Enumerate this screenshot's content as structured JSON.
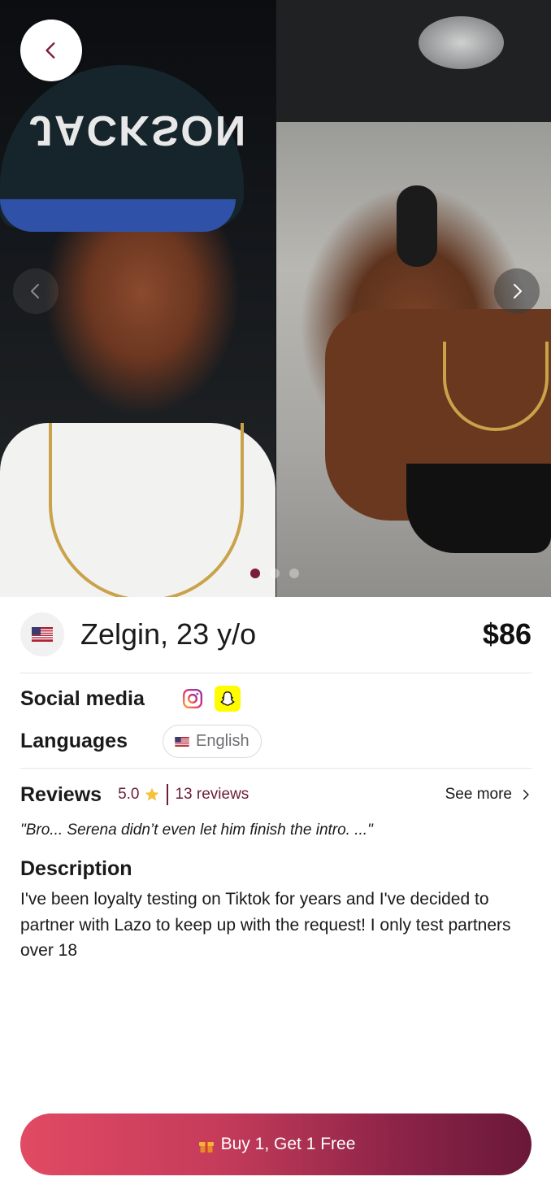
{
  "profile": {
    "name_age": "Zelgin, 23 y/o",
    "price": "$86",
    "country_flag_icon": "us-flag-icon"
  },
  "gallery": {
    "photo_count": 3,
    "active_index": 0,
    "cap_text": "JACKSON"
  },
  "social": {
    "label": "Social media",
    "icons": [
      "instagram-icon",
      "snapchat-icon"
    ]
  },
  "languages": {
    "label": "Languages",
    "items": [
      "English"
    ]
  },
  "reviews": {
    "title": "Reviews",
    "rating": "5.0",
    "count": "13 reviews",
    "see_more": "See more",
    "quote": "\"Bro... Serena didn’t even let him finish the intro. ...\""
  },
  "description": {
    "title": "Description",
    "text": "I've been loyalty testing on Tiktok for years and I've decided to partner with Lazo to keep up with the request! I only test partners over 18"
  },
  "cta": {
    "label": "Buy 1, Get 1 Free",
    "icon": "gift-icon"
  },
  "colors": {
    "accent": "#6b1d3b",
    "cta_start": "#e14a63",
    "cta_end": "#6a1838"
  }
}
